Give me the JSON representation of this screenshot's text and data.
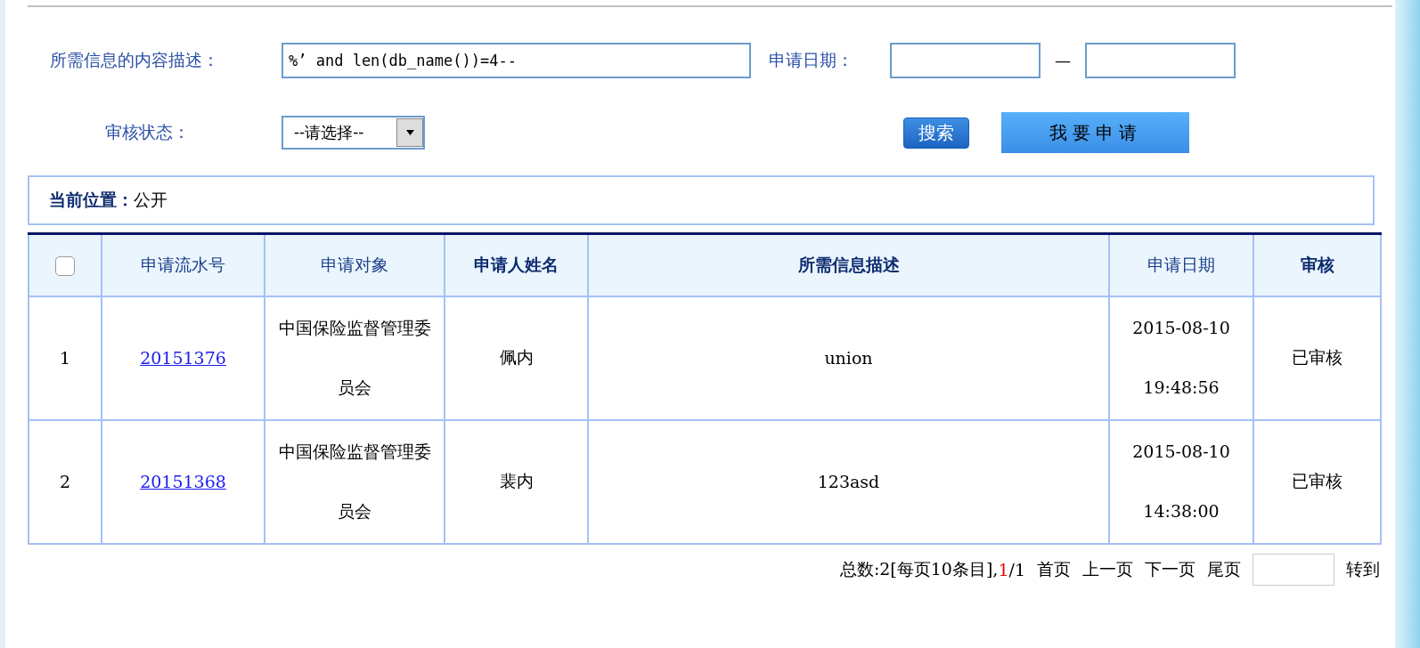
{
  "search_form": {
    "description_label": "所需信息的内容描述：",
    "description_value": "%’ and len(db_name())=4--",
    "date_label": "申请日期：",
    "date_separator": "—",
    "status_label": "审核状态：",
    "status_select": "--请选择--",
    "search_button": "搜索",
    "apply_button": "我要申请"
  },
  "breadcrumb": {
    "label": "当前位置：",
    "value": "公开"
  },
  "table": {
    "select_all_checked": false,
    "columns": [
      {
        "label": "申请流水号",
        "bold": false
      },
      {
        "label": "申请对象",
        "bold": false
      },
      {
        "label": "申请人姓名",
        "bold": true
      },
      {
        "label": "所需信息描述",
        "bold": true
      },
      {
        "label": "申请日期",
        "bold": false
      },
      {
        "label": "审核",
        "bold": true
      }
    ],
    "rows": [
      {
        "index": "1",
        "serial": "20151376",
        "target": "中国保险监督管理委员会",
        "applicant": "佩内",
        "description": "union",
        "date": "2015-08-10",
        "time": "19:48:56",
        "status": "已审核"
      },
      {
        "index": "2",
        "serial": "20151368",
        "target": "中国保险监督管理委员会",
        "applicant": "裴内",
        "description": "123asd",
        "date": "2015-08-10",
        "time": "14:38:00",
        "status": "已审核"
      }
    ]
  },
  "pagination": {
    "total": "总数:2[每页10条目],",
    "current_page": "1",
    "page_count": "/1",
    "links": [
      "首页",
      "上一页",
      "下一页",
      "尾页"
    ],
    "goto_label": "转到"
  }
}
